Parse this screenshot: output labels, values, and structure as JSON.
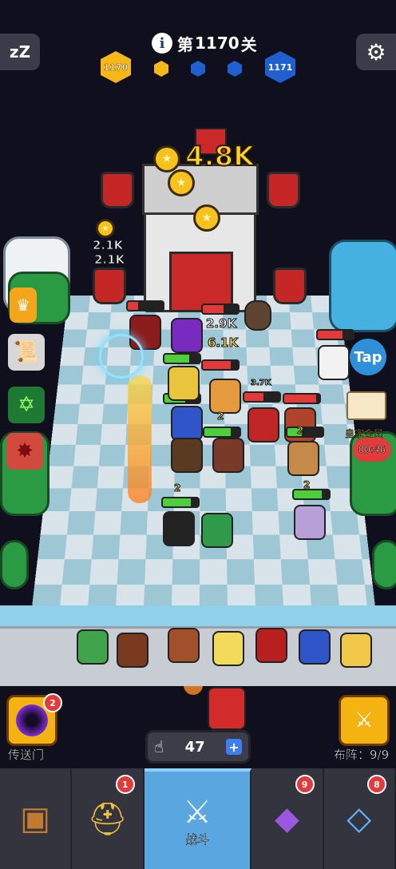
{
  "top_bar": {
    "sleep_icon": "zzz-icon",
    "sleep_text": "zZ",
    "settings_icon": "gear-icon",
    "level_prefix": "第",
    "level_number": "1170",
    "level_suffix": "关",
    "info_glyph": "i"
  },
  "progress": {
    "current_level": "1170",
    "next_level": "1171",
    "stage_dots": [
      "gold",
      "blue",
      "blue"
    ],
    "colors": {
      "gold": "#f5b816",
      "blue": "#1f5fd0"
    }
  },
  "battle": {
    "reward_amount": "4.8K",
    "floating_damage": [
      "2.1K",
      "2.1K",
      "2.9K",
      "6.1K",
      "3.7K"
    ],
    "unit_levels": [
      "2",
      "2",
      "2",
      "2"
    ],
    "tap_label": "Tap",
    "vip_label": "皇家会员",
    "vip_timer": "00:46"
  },
  "controls": {
    "portal_label": "传送门",
    "portal_badge": "2",
    "formation_label": "布阵：",
    "formation_value": "9/9",
    "energy_value": "47",
    "energy_plus": "+"
  },
  "nav": {
    "items": [
      {
        "name": "treasure-chest",
        "icon": "chest-icon",
        "badge": ""
      },
      {
        "name": "helmet",
        "icon": "helmet-icon",
        "badge": "1"
      },
      {
        "name": "battle",
        "icon": "swords-icon",
        "label": "战斗",
        "badge": ""
      },
      {
        "name": "spellbook",
        "icon": "book-icon",
        "badge": "9"
      },
      {
        "name": "amulet",
        "icon": "amulet-icon",
        "badge": "8"
      }
    ]
  }
}
